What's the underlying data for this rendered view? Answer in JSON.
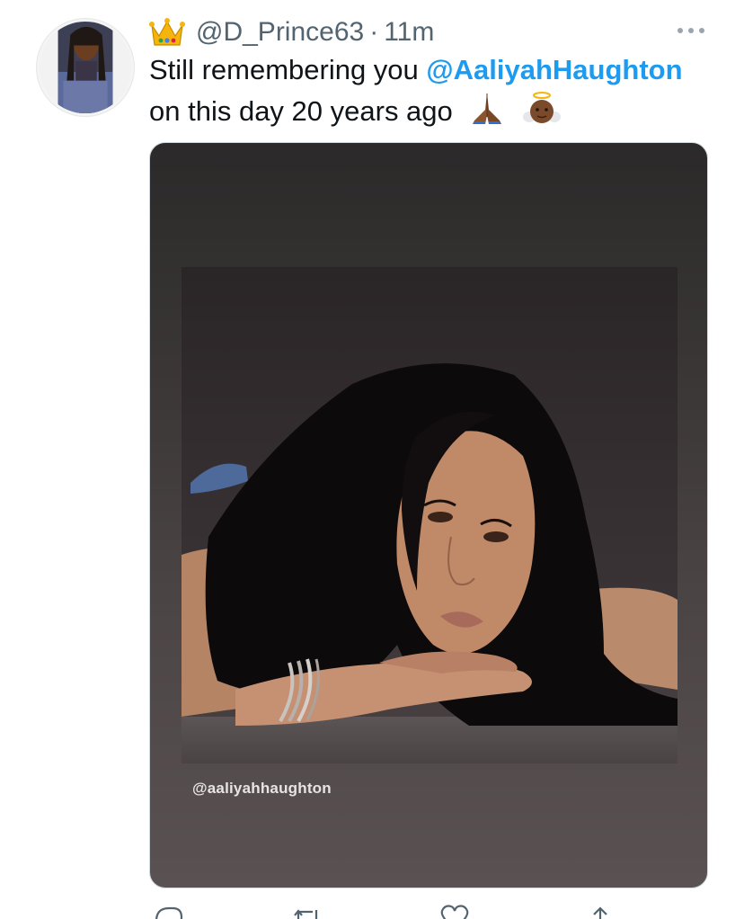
{
  "tweet": {
    "handle": "@D_Prince63",
    "separator": "·",
    "time": "11m",
    "text_before": "Still remembering you ",
    "mention": "@AaliyahHaughton",
    "text_after": "on this day 20 years ago",
    "emojis": [
      "crown-emoji",
      "folded-hands-emoji",
      "baby-angel-emoji"
    ]
  },
  "media": {
    "watermark": "@aaliyahhaughton"
  },
  "actions": [
    "reply-icon",
    "retweet-icon",
    "like-icon",
    "share-icon"
  ],
  "colors": {
    "link": "#1d9bf0",
    "muted": "#536471",
    "text": "#0f1419",
    "border": "#cfd9de"
  }
}
